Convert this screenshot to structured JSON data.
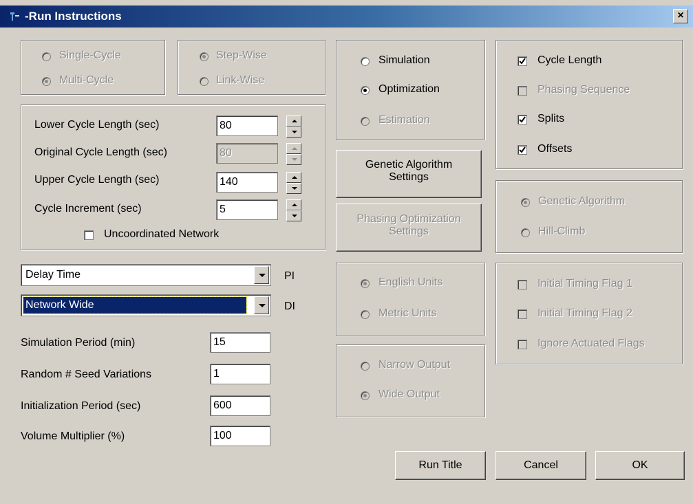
{
  "window": {
    "title": "-Run Instructions",
    "close_label": "×"
  },
  "cycle_mode": {
    "single": "Single-Cycle",
    "multi": "Multi-Cycle"
  },
  "step_mode": {
    "step": "Step-Wise",
    "link": "Link-Wise"
  },
  "cycle_settings": {
    "lower_label": "Lower Cycle Length (sec)",
    "lower_value": "80",
    "original_label": "Original Cycle Length (sec)",
    "original_value": "80",
    "upper_label": "Upper Cycle Length (sec)",
    "upper_value": "140",
    "increment_label": "Cycle Increment (sec)",
    "increment_value": "5",
    "uncoordinated_label": "Uncoordinated Network"
  },
  "pi": {
    "value": "Delay Time",
    "label": "PI"
  },
  "di": {
    "value": "Network Wide",
    "label": "DI"
  },
  "params": {
    "sim_period_label": "Simulation Period (min)",
    "sim_period_value": "15",
    "seed_label": "Random # Seed Variations",
    "seed_value": "1",
    "init_label": "Initialization Period (sec)",
    "init_value": "600",
    "volume_label": "Volume Multiplier (%)",
    "volume_value": "100"
  },
  "mode": {
    "simulation": "Simulation",
    "optimization": "Optimization",
    "estimation": "Estimation"
  },
  "buttons": {
    "ga_line1": "Genetic Algorithm",
    "ga_line2": "Settings",
    "phasing_line1": "Phasing Optimization",
    "phasing_line2": "Settings",
    "run_title": "Run Title",
    "cancel": "Cancel",
    "ok": "OK"
  },
  "units": {
    "english": "English Units",
    "metric": "Metric Units"
  },
  "output": {
    "narrow": "Narrow Output",
    "wide": "Wide Output"
  },
  "optimize": {
    "cycle_length": "Cycle Length",
    "phasing_sequence": "Phasing Sequence",
    "splits": "Splits",
    "offsets": "Offsets"
  },
  "algorithm": {
    "genetic": "Genetic Algorithm",
    "hill": "Hill-Climb"
  },
  "flags": {
    "flag1": "Initial Timing Flag 1",
    "flag2": "Initial Timing Flag 2",
    "ignore": "Ignore Actuated Flags"
  }
}
